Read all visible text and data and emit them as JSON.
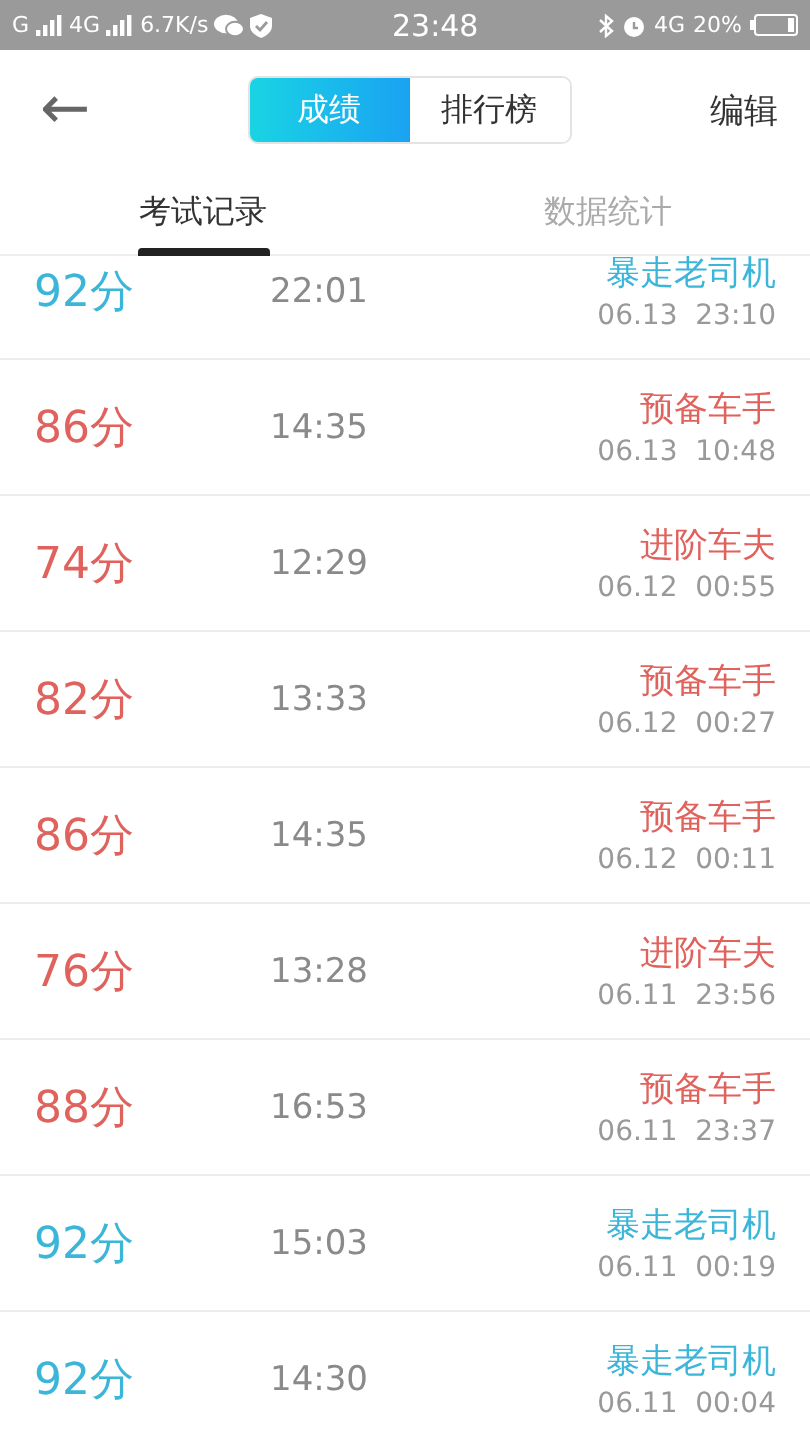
{
  "status_bar": {
    "carrier_1": "G",
    "carrier_2": "4G",
    "speed": "6.7K/s",
    "time": "23:48",
    "network": "4G",
    "battery": "20%"
  },
  "header": {
    "back": "←",
    "segments": [
      {
        "label": "成绩",
        "selected": true
      },
      {
        "label": "排行榜",
        "selected": false
      }
    ],
    "edit": "编辑"
  },
  "tabs": [
    {
      "label": "考试记录",
      "selected": true
    },
    {
      "label": "数据统计",
      "selected": false
    }
  ],
  "records": [
    {
      "score": "92分",
      "duration": "22:01",
      "title": "暴走老司机",
      "date": "06.13  23:10",
      "color": "#3bb6d9"
    },
    {
      "score": "86分",
      "duration": "14:35",
      "title": "预备车手",
      "date": "06.13  10:48",
      "color": "#e0625c"
    },
    {
      "score": "74分",
      "duration": "12:29",
      "title": "进阶车夫",
      "date": "06.12  00:55",
      "color": "#e0625c"
    },
    {
      "score": "82分",
      "duration": "13:33",
      "title": "预备车手",
      "date": "06.12  00:27",
      "color": "#e0625c"
    },
    {
      "score": "86分",
      "duration": "14:35",
      "title": "预备车手",
      "date": "06.12  00:11",
      "color": "#e0625c"
    },
    {
      "score": "76分",
      "duration": "13:28",
      "title": "进阶车夫",
      "date": "06.11  23:56",
      "color": "#e0625c"
    },
    {
      "score": "88分",
      "duration": "16:53",
      "title": "预备车手",
      "date": "06.11  23:37",
      "color": "#e0625c"
    },
    {
      "score": "92分",
      "duration": "15:03",
      "title": "暴走老司机",
      "date": "06.11  00:19",
      "color": "#3bb6d9"
    },
    {
      "score": "92分",
      "duration": "14:30",
      "title": "暴走老司机",
      "date": "06.11  00:04",
      "color": "#3bb6d9"
    }
  ]
}
